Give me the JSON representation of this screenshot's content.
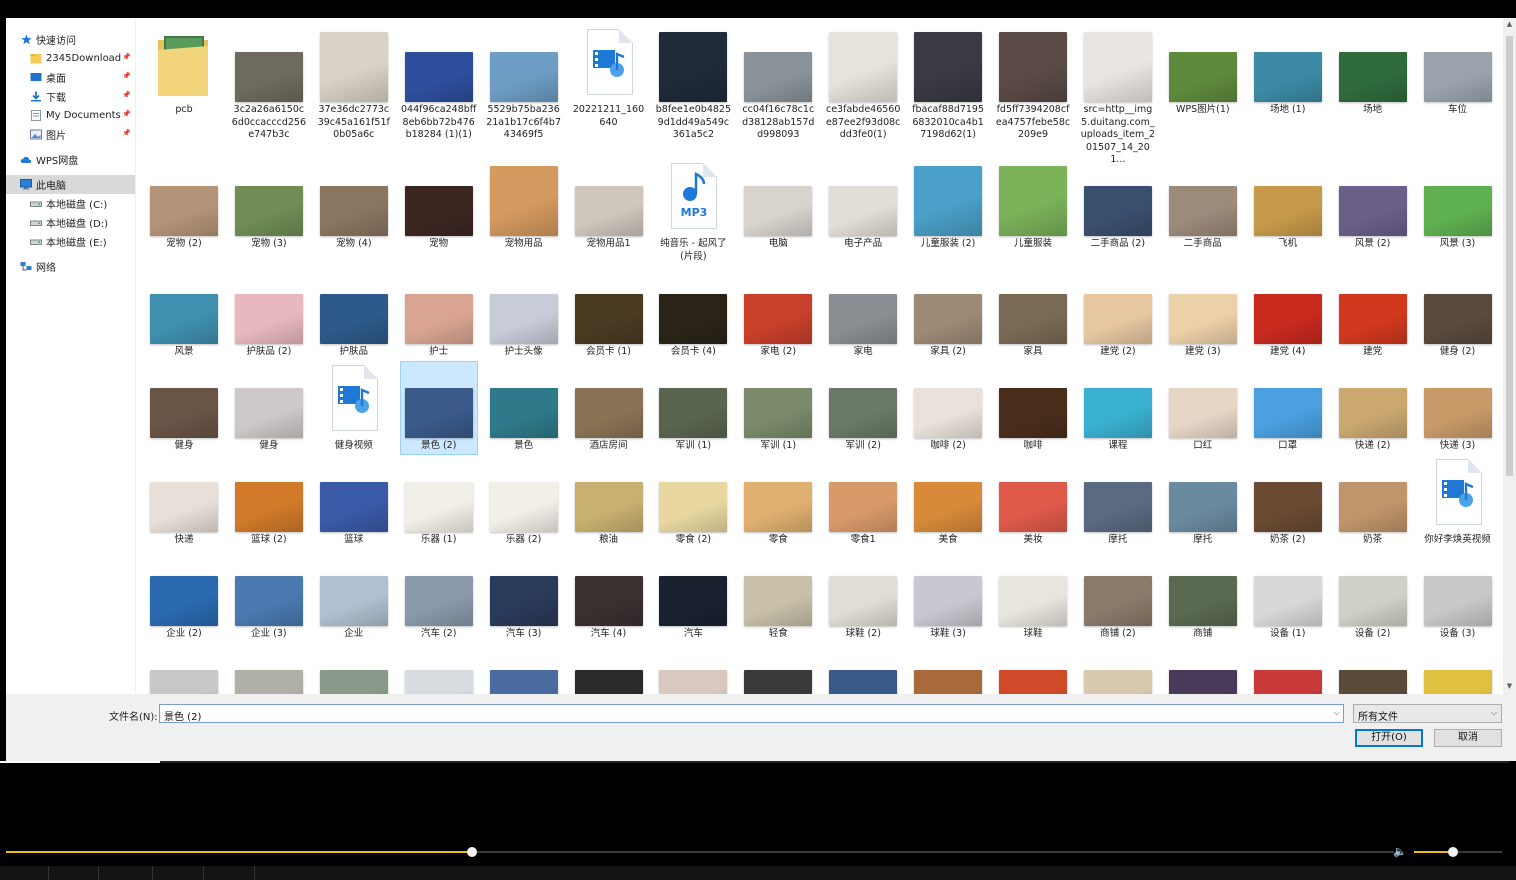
{
  "nav": {
    "items": [
      {
        "label": "快速访问",
        "icon": "star-icon",
        "pin": false
      },
      {
        "label": "2345Download",
        "icon": "folder-icon",
        "pin": true
      },
      {
        "label": "桌面",
        "icon": "desktop-icon",
        "pin": true
      },
      {
        "label": "下载",
        "icon": "download-icon",
        "pin": true
      },
      {
        "label": "My Documents",
        "icon": "documents-icon",
        "pin": true
      },
      {
        "label": "图片",
        "icon": "pictures-icon",
        "pin": true
      },
      {
        "label": "WPS网盘",
        "icon": "cloud-icon",
        "pin": false
      },
      {
        "label": "此电脑",
        "icon": "computer-icon",
        "pin": false,
        "selected": true
      },
      {
        "label": "本地磁盘 (C:)",
        "icon": "drive-icon",
        "pin": false
      },
      {
        "label": "本地磁盘 (D:)",
        "icon": "drive-icon",
        "pin": false
      },
      {
        "label": "本地磁盘 (E:)",
        "icon": "drive-icon",
        "pin": false
      },
      {
        "label": "网络",
        "icon": "network-icon",
        "pin": false
      }
    ]
  },
  "files": {
    "rows": [
      [
        {
          "name": "pcb",
          "kind": "folder"
        },
        {
          "name": "3c2a26a6150c6d0ccacccd256e747b3c",
          "kind": "image",
          "color": "#6f6a5e"
        },
        {
          "name": "37e36dc2773c39c45a161f51f0b05a6c",
          "kind": "image",
          "color": "#d9d2c8"
        },
        {
          "name": "044f96ca248bff8eb6bb72b476b18284 (1)(1)",
          "kind": "image",
          "color": "#2e4f9e"
        },
        {
          "name": "5529b75ba23621a1b17c6f4b743469f5",
          "kind": "image",
          "color": "#6d9cc4"
        },
        {
          "name": "20221211_160640",
          "kind": "video"
        },
        {
          "name": "b8fee1e0b48259d1dd49a549c361a5c2",
          "kind": "image",
          "color": "#1f2a3a"
        },
        {
          "name": "cc04f16c78c1cd38128ab157dd998093",
          "kind": "image",
          "color": "#8a939a"
        },
        {
          "name": "ce3fabde46560e87ee2f93d08cdd3fe0(1)",
          "kind": "image",
          "color": "#e8e2dc"
        },
        {
          "name": "fbacaf88d71956832010ca4b17198d62(1)",
          "kind": "image",
          "color": "#3a3a44"
        },
        {
          "name": "fd5ff7394208cfea4757febe58c209e9",
          "kind": "image",
          "color": "#5a4b46"
        },
        {
          "name": "src=http__img5.duitang.com_uploads_item_201507_14_201...",
          "kind": "image",
          "color": "#e9e6e1"
        },
        {
          "name": "WPS图片(1)",
          "kind": "image",
          "color": "#5f8a3c"
        },
        {
          "name": "场地 (1)",
          "kind": "image",
          "color": "#3c8aa6"
        },
        {
          "name": "场地",
          "kind": "image",
          "color": "#2f6b3d"
        },
        {
          "name": "车位",
          "kind": "image",
          "color": "#9aa3ad"
        }
      ],
      [
        {
          "name": "宠物 (2)",
          "kind": "image",
          "color": "#b49478"
        },
        {
          "name": "宠物 (3)",
          "kind": "image",
          "color": "#6f8d55"
        },
        {
          "name": "宠物 (4)",
          "kind": "image",
          "color": "#8a7560"
        },
        {
          "name": "宠物",
          "kind": "image",
          "color": "#3c2622"
        },
        {
          "name": "宠物用品",
          "kind": "image",
          "color": "#d59a60"
        },
        {
          "name": "宠物用品1",
          "kind": "image",
          "color": "#cfc6bd"
        },
        {
          "name": "纯音乐 - 起风了 (片段)",
          "kind": "audio"
        },
        {
          "name": "电脑",
          "kind": "image",
          "color": "#d8d3cd"
        },
        {
          "name": "电子产品",
          "kind": "image",
          "color": "#e2ddd6"
        },
        {
          "name": "儿童服装 (2)",
          "kind": "image",
          "color": "#4aa0c8"
        },
        {
          "name": "儿童服装",
          "kind": "image",
          "color": "#7bb25a"
        },
        {
          "name": "二手商品 (2)",
          "kind": "image",
          "color": "#3a4f6e"
        },
        {
          "name": "二手商品",
          "kind": "image",
          "color": "#9c8a7a"
        },
        {
          "name": "飞机",
          "kind": "image",
          "color": "#c79a4a"
        },
        {
          "name": "风景 (2)",
          "kind": "image",
          "color": "#6b5f8a"
        },
        {
          "name": "风景 (3)",
          "kind": "image",
          "color": "#5fb050"
        }
      ],
      [
        {
          "name": "风景",
          "kind": "image",
          "color": "#3f8fb0"
        },
        {
          "name": "护肤品 (2)",
          "kind": "image",
          "color": "#e8b8bf"
        },
        {
          "name": "护肤品",
          "kind": "image",
          "color": "#2d5a8a"
        },
        {
          "name": "护士",
          "kind": "image",
          "color": "#d9a592"
        },
        {
          "name": "护士头像",
          "kind": "image",
          "color": "#c8ccd8"
        },
        {
          "name": "会员卡 (1)",
          "kind": "image",
          "color": "#4a3a22"
        },
        {
          "name": "会员卡 (4)",
          "kind": "image",
          "color": "#2a2418"
        },
        {
          "name": "家电 (2)",
          "kind": "image",
          "color": "#c8402a"
        },
        {
          "name": "家电",
          "kind": "image",
          "color": "#8a8e92"
        },
        {
          "name": "家具 (2)",
          "kind": "image",
          "color": "#9c8a75"
        },
        {
          "name": "家具",
          "kind": "image",
          "color": "#7a6a55"
        },
        {
          "name": "建党 (2)",
          "kind": "image",
          "color": "#e6c7a0"
        },
        {
          "name": "建党 (3)",
          "kind": "image",
          "color": "#ecd0a8"
        },
        {
          "name": "建党 (4)",
          "kind": "image",
          "color": "#c82a1e"
        },
        {
          "name": "建党",
          "kind": "image",
          "color": "#d2381e"
        },
        {
          "name": "健身 (2)",
          "kind": "image",
          "color": "#5a4a3e"
        }
      ],
      [
        {
          "name": "健身",
          "kind": "image",
          "color": "#6a5446"
        },
        {
          "name": "健身",
          "kind": "image",
          "color": "#cfc8c8"
        },
        {
          "name": "健身视频",
          "kind": "video"
        },
        {
          "name": "景色 (2)",
          "kind": "image",
          "color": "#3a5a8a",
          "selected": true
        },
        {
          "name": "景色",
          "kind": "image",
          "color": "#2f7a8a"
        },
        {
          "name": "酒店房间",
          "kind": "image",
          "color": "#8a7355"
        },
        {
          "name": "军训 (1)",
          "kind": "image",
          "color": "#5a6550"
        },
        {
          "name": "军训 (1)",
          "kind": "image",
          "color": "#7a8a6a"
        },
        {
          "name": "军训 (2)",
          "kind": "image",
          "color": "#6a7a66"
        },
        {
          "name": "咖啡 (2)",
          "kind": "image",
          "color": "#e8e2da"
        },
        {
          "name": "咖啡",
          "kind": "image",
          "color": "#4a2e1c"
        },
        {
          "name": "课程",
          "kind": "image",
          "color": "#3ab0d0"
        },
        {
          "name": "口红",
          "kind": "image",
          "color": "#e6d6c6"
        },
        {
          "name": "口罩",
          "kind": "image",
          "color": "#4aa0e0"
        },
        {
          "name": "快递 (2)",
          "kind": "image",
          "color": "#caa870"
        },
        {
          "name": "快递 (3)",
          "kind": "image",
          "color": "#c89a68"
        }
      ],
      [
        {
          "name": "快递",
          "kind": "image",
          "color": "#e8e0d8"
        },
        {
          "name": "篮球 (2)",
          "kind": "image",
          "color": "#d07a2a"
        },
        {
          "name": "篮球",
          "kind": "image",
          "color": "#3a5aa8"
        },
        {
          "name": "乐器 (1)",
          "kind": "image",
          "color": "#f2eee8"
        },
        {
          "name": "乐器 (2)",
          "kind": "image",
          "color": "#f2eee8"
        },
        {
          "name": "粮油",
          "kind": "image",
          "color": "#c8b070"
        },
        {
          "name": "零食 (2)",
          "kind": "image",
          "color": "#e8d8a0"
        },
        {
          "name": "零食",
          "kind": "image",
          "color": "#e0b070"
        },
        {
          "name": "零食1",
          "kind": "image",
          "color": "#d89a6a"
        },
        {
          "name": "美食",
          "kind": "image",
          "color": "#d88a3a"
        },
        {
          "name": "美妆",
          "kind": "image",
          "color": "#e05a4a"
        },
        {
          "name": "摩托",
          "kind": "image",
          "color": "#5a6a80"
        },
        {
          "name": "摩托",
          "kind": "image",
          "color": "#6a8aa0"
        },
        {
          "name": "奶茶 (2)",
          "kind": "image",
          "color": "#6a4a32"
        },
        {
          "name": "奶茶",
          "kind": "image",
          "color": "#c0956a"
        },
        {
          "name": "你好李焕英视频",
          "kind": "video"
        }
      ],
      [
        {
          "name": "企业 (2)",
          "kind": "image",
          "color": "#2a6ab0"
        },
        {
          "name": "企业 (3)",
          "kind": "image",
          "color": "#4a7ab0"
        },
        {
          "name": "企业",
          "kind": "image",
          "color": "#b0c0d0"
        },
        {
          "name": "汽车 (2)",
          "kind": "image",
          "color": "#8a9aaa"
        },
        {
          "name": "汽车 (3)",
          "kind": "image",
          "color": "#2a3a5a"
        },
        {
          "name": "汽车 (4)",
          "kind": "image",
          "color": "#3a3030"
        },
        {
          "name": "汽车",
          "kind": "image",
          "color": "#1a2230"
        },
        {
          "name": "轻食",
          "kind": "image",
          "color": "#c8c0a8"
        },
        {
          "name": "球鞋 (2)",
          "kind": "image",
          "color": "#e0ddd6"
        },
        {
          "name": "球鞋 (3)",
          "kind": "image",
          "color": "#c8c8d0"
        },
        {
          "name": "球鞋",
          "kind": "image",
          "color": "#e8e4de"
        },
        {
          "name": "商铺 (2)",
          "kind": "image",
          "color": "#8a7a6a"
        },
        {
          "name": "商铺",
          "kind": "image",
          "color": "#5a6a50"
        },
        {
          "name": "设备 (1)",
          "kind": "image",
          "color": "#d8d8d8"
        },
        {
          "name": "设备 (2)",
          "kind": "image",
          "color": "#d0d0c8"
        },
        {
          "name": "设备 (3)",
          "kind": "image",
          "color": "#c8c8c8"
        }
      ],
      [
        {
          "name": "",
          "kind": "image",
          "color": "#c8c8c8"
        },
        {
          "name": "",
          "kind": "image",
          "color": "#b0b0a8"
        },
        {
          "name": "",
          "kind": "image",
          "color": "#8a9a8a"
        },
        {
          "name": "",
          "kind": "image",
          "color": "#d8dce0"
        },
        {
          "name": "",
          "kind": "image",
          "color": "#4a6aa0"
        },
        {
          "name": "",
          "kind": "image",
          "color": "#2a2a2a"
        },
        {
          "name": "",
          "kind": "image",
          "color": "#d8c8c0"
        },
        {
          "name": "",
          "kind": "image",
          "color": "#3a3a3a"
        },
        {
          "name": "",
          "kind": "image",
          "color": "#3a5a8a"
        },
        {
          "name": "",
          "kind": "image",
          "color": "#a86a3a"
        },
        {
          "name": "",
          "kind": "image",
          "color": "#d04a2a"
        },
        {
          "name": "",
          "kind": "image",
          "color": "#d8c8b0"
        },
        {
          "name": "",
          "kind": "image",
          "color": "#4a3a5a"
        },
        {
          "name": "",
          "kind": "image",
          "color": "#c83a3a"
        },
        {
          "name": "",
          "kind": "image",
          "color": "#5a4a3a"
        },
        {
          "name": "",
          "kind": "image",
          "color": "#e0c040"
        }
      ]
    ]
  },
  "footer": {
    "filename_label": "文件名(N):",
    "filename_value": "景色 (2)",
    "filetype_value": "所有文件",
    "open_button": "打开(O)",
    "cancel_button": "取消"
  },
  "player": {
    "progress": 0.336,
    "volume": 0.44,
    "accent_color": "#f0c000"
  }
}
